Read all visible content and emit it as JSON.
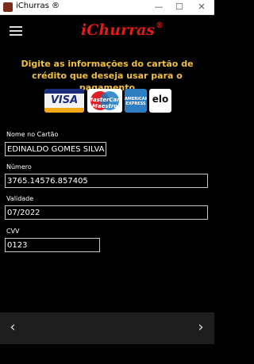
{
  "window": {
    "title": "iChurras ®",
    "minimize_icon": "minimize-icon",
    "maximize_icon": "maximize-icon",
    "close_icon": "close-icon"
  },
  "appbar": {
    "brand": "iChurras",
    "brand_mark": "®",
    "menu_icon": "hamburger-icon"
  },
  "instructions": "Digite as informações do cartão de crédito que deseja usar para o pagamento",
  "cards": [
    {
      "name": "VISA"
    },
    {
      "name": "MasterCard Maestro"
    },
    {
      "name": "AMERICAN EXPRESS"
    },
    {
      "name": "elo"
    }
  ],
  "form": {
    "name_label": "Nome no Cartão",
    "name_value": "EDINALDO GOMES SILVA",
    "number_label": "Número",
    "number_value": "3765.14576.857405",
    "expiry_label": "Validade",
    "expiry_value": "07/2022",
    "cvv_label": "CVV",
    "cvv_value": "0123"
  },
  "footer": {
    "prev_icon": "chevron-left-icon",
    "next_icon": "chevron-right-icon"
  },
  "colors": {
    "accent_text": "#f0c040",
    "brand": "#e11b1b"
  }
}
